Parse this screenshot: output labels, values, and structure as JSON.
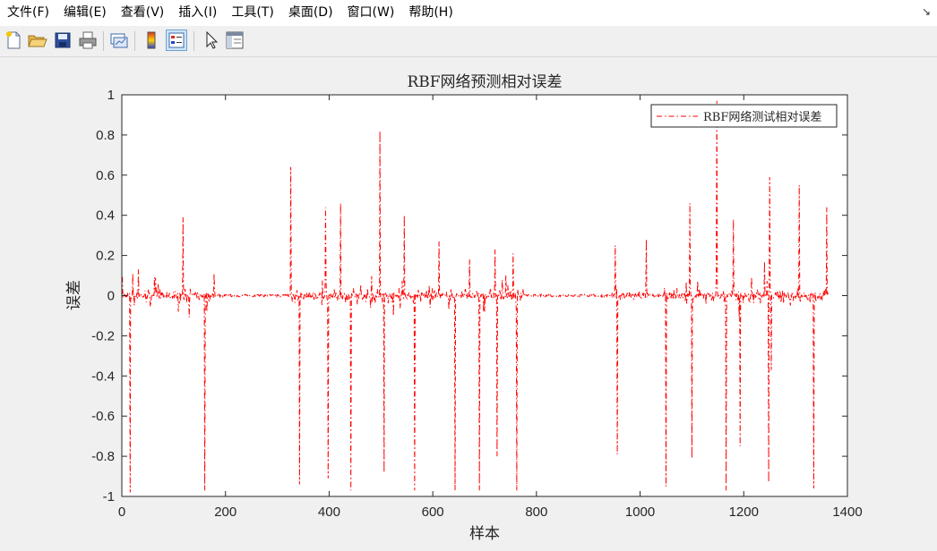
{
  "menubar": {
    "items": [
      "文件(F)",
      "编辑(E)",
      "查看(V)",
      "插入(I)",
      "工具(T)",
      "桌面(D)",
      "窗口(W)",
      "帮助(H)"
    ],
    "dock_icon": "undock-arrow-icon"
  },
  "toolbar": {
    "icons": [
      "new-figure-icon",
      "open-file-icon",
      "save-icon",
      "print-icon",
      "link-plot-icon",
      "colorbar-icon",
      "legend-icon",
      "pointer-icon",
      "property-inspector-icon"
    ]
  },
  "colors": {
    "series": "#ff0000",
    "axes": "#262626",
    "figure_bg": "#f0f0f0",
    "plot_bg": "#ffffff"
  },
  "chart_data": {
    "type": "line",
    "title": "RBF网络预测相对误差",
    "xlabel": "样本",
    "ylabel": "误差",
    "xlim": [
      0,
      1400
    ],
    "ylim": [
      -1,
      1
    ],
    "xticks": [
      0,
      200,
      400,
      600,
      800,
      1000,
      1200,
      1400
    ],
    "yticks": [
      -1,
      -0.8,
      -0.6,
      -0.4,
      -0.2,
      0,
      0.2,
      0.4,
      0.6,
      0.8,
      1
    ],
    "xtick_labels": [
      "0",
      "200",
      "400",
      "600",
      "800",
      "1000",
      "1200",
      "1400"
    ],
    "ytick_labels": [
      "-1",
      "-0.8",
      "-0.6",
      "-0.4",
      "-0.2",
      "0",
      "0.2",
      "0.4",
      "0.6",
      "0.8",
      "1"
    ],
    "grid": false,
    "legend_position": "top-right",
    "series": [
      {
        "name": "RBF网络测试相对误差",
        "line_style": "dash-dot",
        "x_range": [
          1,
          1363
        ],
        "spikes": [
          {
            "x": 16,
            "y": -0.98
          },
          {
            "x": 21,
            "y": 0.11
          },
          {
            "x": 32,
            "y": 0.13
          },
          {
            "x": 118,
            "y": 0.39
          },
          {
            "x": 160,
            "y": -0.97
          },
          {
            "x": 178,
            "y": 0.11
          },
          {
            "x": 326,
            "y": 0.64
          },
          {
            "x": 343,
            "y": -0.94
          },
          {
            "x": 393,
            "y": 0.44
          },
          {
            "x": 398,
            "y": -0.91
          },
          {
            "x": 422,
            "y": 0.46
          },
          {
            "x": 442,
            "y": -0.97
          },
          {
            "x": 498,
            "y": 0.82
          },
          {
            "x": 506,
            "y": -0.88
          },
          {
            "x": 545,
            "y": 0.4
          },
          {
            "x": 565,
            "y": -0.97
          },
          {
            "x": 612,
            "y": 0.27
          },
          {
            "x": 643,
            "y": -0.97
          },
          {
            "x": 671,
            "y": 0.18
          },
          {
            "x": 690,
            "y": -0.97
          },
          {
            "x": 720,
            "y": 0.23
          },
          {
            "x": 724,
            "y": -0.8
          },
          {
            "x": 755,
            "y": 0.21
          },
          {
            "x": 762,
            "y": -0.97
          },
          {
            "x": 952,
            "y": 0.25
          },
          {
            "x": 956,
            "y": -0.79
          },
          {
            "x": 1012,
            "y": 0.28
          },
          {
            "x": 1050,
            "y": -0.95
          },
          {
            "x": 1096,
            "y": 0.46
          },
          {
            "x": 1100,
            "y": -0.81
          },
          {
            "x": 1148,
            "y": 0.97
          },
          {
            "x": 1166,
            "y": -0.97
          },
          {
            "x": 1180,
            "y": 0.38
          },
          {
            "x": 1193,
            "y": -0.75
          },
          {
            "x": 1240,
            "y": 0.17
          },
          {
            "x": 1248,
            "y": -0.93
          },
          {
            "x": 1250,
            "y": 0.59
          },
          {
            "x": 1253,
            "y": -0.37
          },
          {
            "x": 1307,
            "y": 0.55
          },
          {
            "x": 1335,
            "y": -0.96
          },
          {
            "x": 1360,
            "y": 0.44
          }
        ],
        "quiet_ranges": [
          [
            180,
            315
          ],
          [
            775,
            945
          ],
          [
            1020,
            1045
          ]
        ]
      }
    ]
  }
}
